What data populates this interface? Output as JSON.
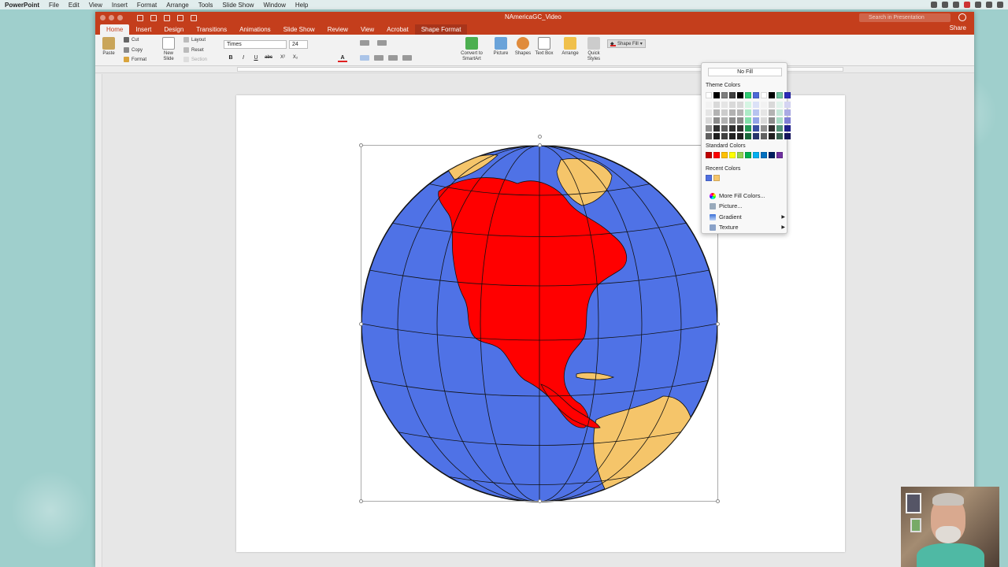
{
  "menubar": {
    "app": "PowerPoint",
    "items": [
      "File",
      "Edit",
      "View",
      "Insert",
      "Format",
      "Arrange",
      "Tools",
      "Slide Show",
      "Window",
      "Help"
    ]
  },
  "window": {
    "title": "NAmericaGC_Video",
    "search_placeholder": "Search in Presentation",
    "share": "Share"
  },
  "tabs": [
    "Home",
    "Insert",
    "Design",
    "Transitions",
    "Animations",
    "Slide Show",
    "Review",
    "View",
    "Acrobat",
    "Shape Format"
  ],
  "ribbon": {
    "paste": "Paste",
    "cut": "Cut",
    "copy": "Copy",
    "format": "Format",
    "new_slide": "New Slide",
    "layout": "Layout",
    "reset": "Reset",
    "section": "Section",
    "font_name": "Times",
    "font_size": "24",
    "bold": "B",
    "italic": "I",
    "underline": "U",
    "strike": "abc",
    "superscript": "X²",
    "subscript": "X₂",
    "convert_smartart": "Convert to SmartArt",
    "picture": "Picture",
    "shapes": "Shapes",
    "text_box": "Text Box",
    "arrange": "Arrange",
    "quick_styles": "Quick Styles",
    "shape_fill": "Shape Fill"
  },
  "fill_menu": {
    "no_fill": "No Fill",
    "theme_colors_label": "Theme Colors",
    "theme_colors": [
      "#ffffff",
      "#000000",
      "#7f7f7f",
      "#3f3f3f",
      "#000000",
      "#2ecc71",
      "#4c68d7",
      "#ffffff",
      "#000000",
      "#70c4a0",
      "#2a2ab8"
    ],
    "standard_colors_label": "Standard Colors",
    "standard_colors": [
      "#c00000",
      "#ff0000",
      "#ffc000",
      "#ffff00",
      "#92d050",
      "#00b050",
      "#00b0f0",
      "#0070c0",
      "#002060",
      "#7030a0"
    ],
    "recent_colors_label": "Recent Colors",
    "recent_colors": [
      "#4f6fe0",
      "#f5c56a"
    ],
    "more_fill_colors": "More Fill Colors...",
    "picture": "Picture...",
    "gradient": "Gradient",
    "texture": "Texture"
  },
  "slide": {
    "ocean_color": "#4f72e6",
    "north_america_color": "#ff0000",
    "other_land_color": "#f5c56a"
  }
}
